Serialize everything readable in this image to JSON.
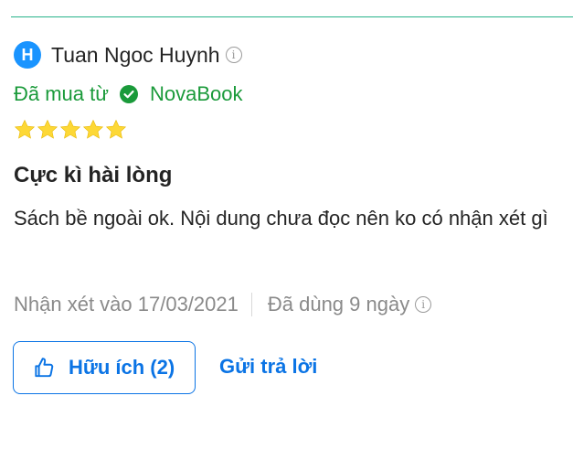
{
  "reviewer": {
    "avatar_letter": "H",
    "name": "Tuan Ngoc Huynh",
    "info_icon": "info-icon"
  },
  "purchase": {
    "prefix": "Đã mua từ",
    "seller": "NovaBook",
    "verified_icon": "check-circle-icon"
  },
  "rating": {
    "stars": 5,
    "max": 5,
    "color": "#fdd836"
  },
  "review": {
    "title": "Cực kì hài lòng",
    "body": "Sách bề ngoài ok. Nội dung chưa đọc nên ko có nhận xét gì"
  },
  "meta": {
    "review_date": "Nhận xét vào 17/03/2021",
    "usage": "Đã dùng 9 ngày",
    "info_icon": "info-icon"
  },
  "actions": {
    "helpful_label": "Hữu ích (2)",
    "helpful_icon": "thumbs-up-icon",
    "reply_label": "Gửi trả lời"
  },
  "colors": {
    "accent": "#0b74e5",
    "verified": "#1a9a3a",
    "avatar_bg": "#1a94ff",
    "divider": "#28b38a"
  }
}
